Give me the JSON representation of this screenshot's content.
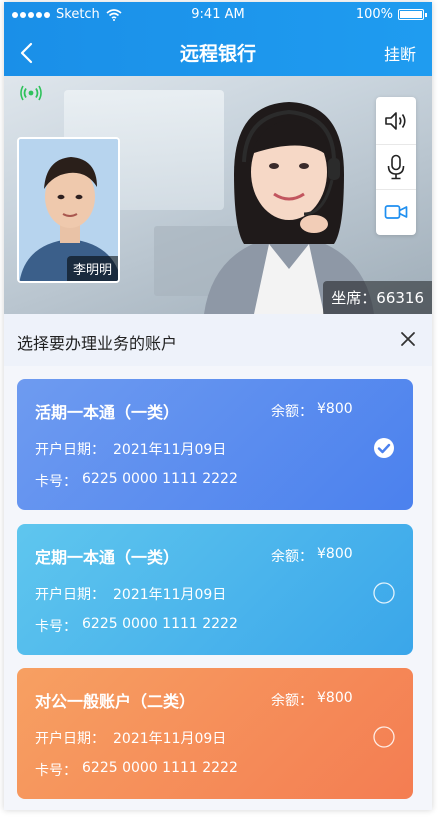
{
  "status_bar": {
    "carrier": "Sketch",
    "time": "9:41 AM",
    "battery": "100%"
  },
  "nav": {
    "title": "远程银行",
    "hangup_label": "挂断"
  },
  "video": {
    "self_name": "李明明",
    "seat_label": "坐席：66316",
    "controls": [
      "speaker-icon",
      "microphone-icon",
      "camera-icon"
    ]
  },
  "sheet": {
    "title": "选择要办理业务的账户",
    "accounts": [
      {
        "name": "活期一本通（一类）",
        "balance_label": "余额：",
        "balance": "¥800",
        "open_label": "开户日期：",
        "open_date": "2021年11月09日",
        "card_label": "卡号：",
        "card_no": "6225 0000 1111 2222",
        "selected": true,
        "color": "#5a8cf0"
      },
      {
        "name": "定期一本通（一类）",
        "balance_label": "余额：",
        "balance": "¥800",
        "open_label": "开户日期：",
        "open_date": "2021年11月09日",
        "card_label": "卡号：",
        "card_no": "6225 0000 1111 2222",
        "selected": false,
        "color": "#47b4ec"
      },
      {
        "name": "对公一般账户（二类）",
        "balance_label": "余额：",
        "balance": "¥800",
        "open_label": "开户日期：",
        "open_date": "2021年11月09日",
        "card_label": "卡号：",
        "card_no": "6225 0000 1111 2222",
        "selected": false,
        "color": "#f58a58"
      }
    ]
  },
  "colors": {
    "nav_bg": "#1a8fe8",
    "signal": "#2fc25b"
  }
}
